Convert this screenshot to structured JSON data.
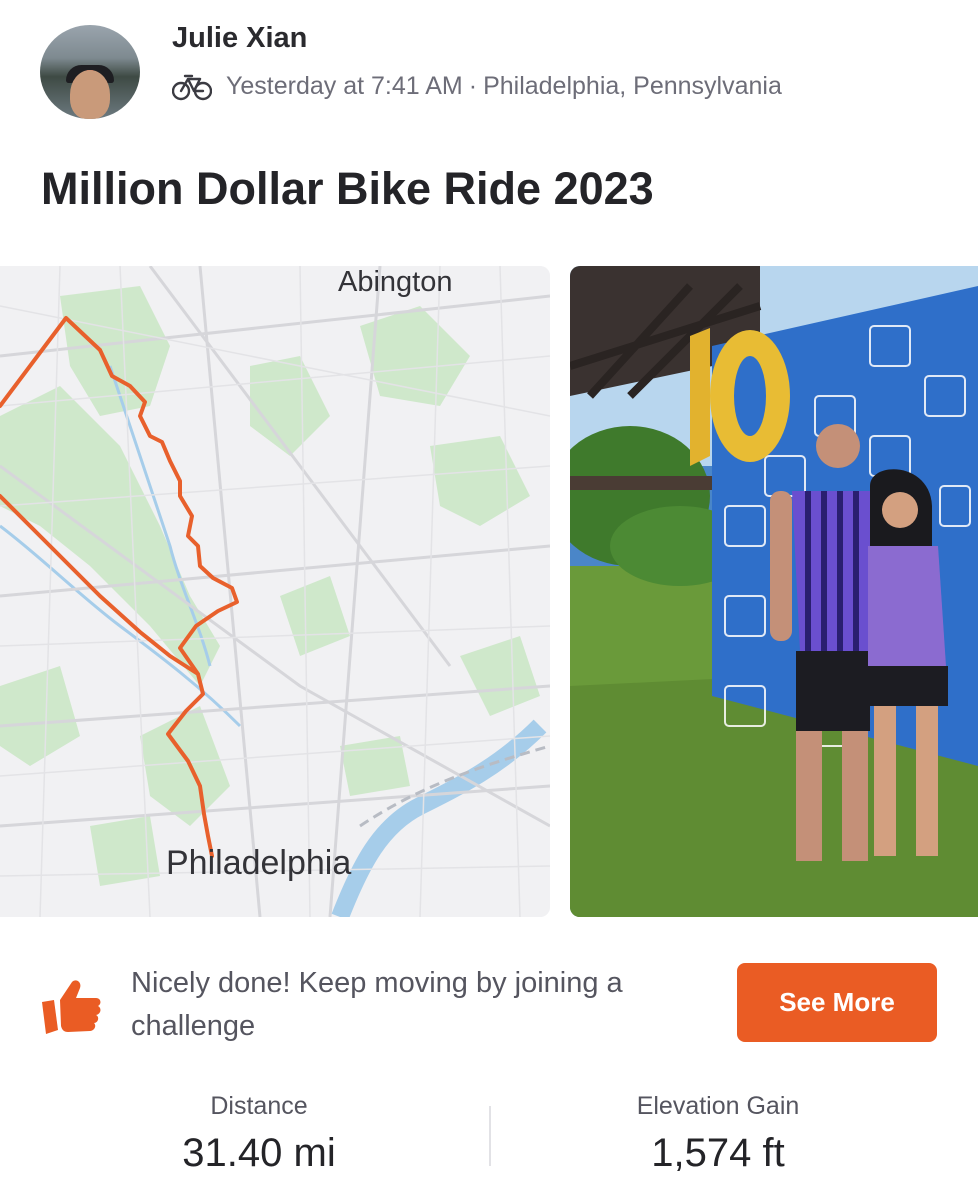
{
  "header": {
    "athlete_name": "Julie Xian",
    "activity_icon": "bike-icon",
    "timestamp": "Yesterday at 7:41 AM",
    "separator": "·",
    "location": "Philadelphia, Pennsylvania"
  },
  "activity": {
    "title": "Million Dollar Bike Ride 2023"
  },
  "map": {
    "labels": {
      "north": "Abington",
      "south": "Philadelphia"
    },
    "route_color": "#e8602c"
  },
  "photo": {
    "balloon_text": "10"
  },
  "prompt": {
    "icon": "thumbs-up-icon",
    "text": "Nicely done! Keep moving by joining a challenge",
    "button_label": "See More",
    "button_color": "#ea5c24"
  },
  "stats": [
    {
      "label": "Distance",
      "value": "31.40 mi"
    },
    {
      "label": "Elevation Gain",
      "value": "1,574 ft"
    }
  ]
}
